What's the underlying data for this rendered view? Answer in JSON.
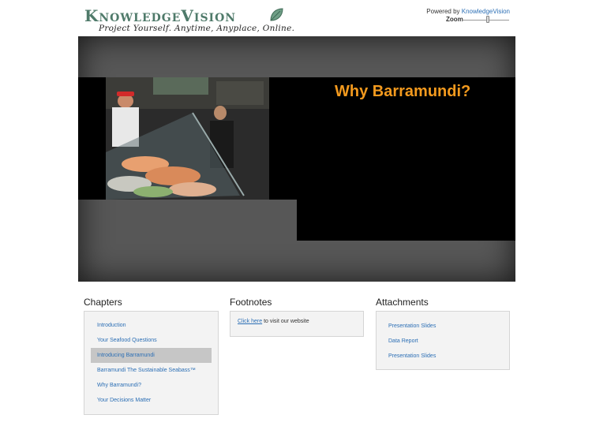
{
  "header": {
    "logo_title": "KnowledgeVision",
    "tagline": "Project Yourself. Anytime, Anyplace, Online.",
    "powered_prefix": "Powered by",
    "powered_link": "KnowledgeVision",
    "zoom_label": "Zoom",
    "zoom_level": 0.55
  },
  "player": {
    "slide_title": "Why Barramundi?",
    "slide_title_color": "#f39a1e"
  },
  "chapters": {
    "heading": "Chapters",
    "items": [
      {
        "label": "Introduction"
      },
      {
        "label": "Your Seafood Questions"
      },
      {
        "label": "Introducing Barramundi"
      },
      {
        "label": "Barramundi The Sustainable Seabass™"
      },
      {
        "label": "Why Barramundi?"
      },
      {
        "label": "Your Decisions Matter"
      }
    ],
    "active_index": 2
  },
  "footnotes": {
    "heading": "Footnotes",
    "link_text": "Click here",
    "rest_text": " to visit our website"
  },
  "attachments": {
    "heading": "Attachments",
    "items": [
      {
        "label": "Presentation Slides"
      },
      {
        "label": "Data Report"
      },
      {
        "label": "Presentation Slides"
      }
    ]
  },
  "colors": {
    "link": "#2c6fb5",
    "logo": "#4f7a6a",
    "player_bg": "#575757"
  }
}
